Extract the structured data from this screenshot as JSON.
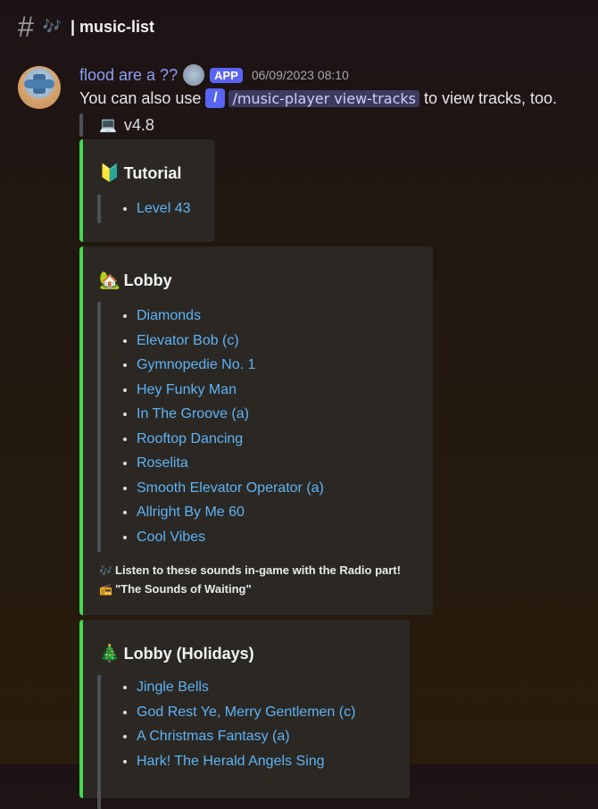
{
  "channel": {
    "hash": "#",
    "icon": "music-notes-icon",
    "icon_glyph": "🎶",
    "name": "| music-list"
  },
  "message": {
    "username": "flood are a ??",
    "badge": "APP",
    "timestamp": "06/09/2023 08:10",
    "text_before": "You can also use",
    "slash_icon": "/",
    "command": "/music-player view-tracks",
    "text_after": "to view tracks, too.",
    "version_icon": "💻",
    "version": "v4.8"
  },
  "embeds": [
    {
      "emoji": "🔰",
      "title": "Tutorial",
      "tracks": [
        "Level 43"
      ]
    },
    {
      "emoji": "🏡",
      "title": "Lobby",
      "tracks": [
        "Diamonds",
        "Elevator Bob (c)",
        "Gymnopedie No. 1",
        "Hey Funky Man",
        "In The Groove (a)",
        "Rooftop Dancing",
        "Roselita",
        "Smooth Elevator Operator (a)",
        "Allright By Me 60",
        "Cool Vibes"
      ],
      "footer": [
        {
          "icon": "🎶",
          "text": "Listen to these sounds in-game with the Radio part!"
        },
        {
          "icon": "📻",
          "text": "\"The Sounds of Waiting\""
        }
      ]
    },
    {
      "emoji": "🎄",
      "title": "Lobby (Holidays)",
      "tracks": [
        "Jingle Bells",
        "God Rest Ye, Merry Gentlemen (c)",
        "A Christmas Fantasy (a)",
        "Hark! The Herald Angels Sing"
      ]
    }
  ],
  "colors": {
    "accent": "#43d94c",
    "link": "#5eb3f5",
    "username": "#8b9ff3",
    "app_badge": "#5865f2"
  }
}
